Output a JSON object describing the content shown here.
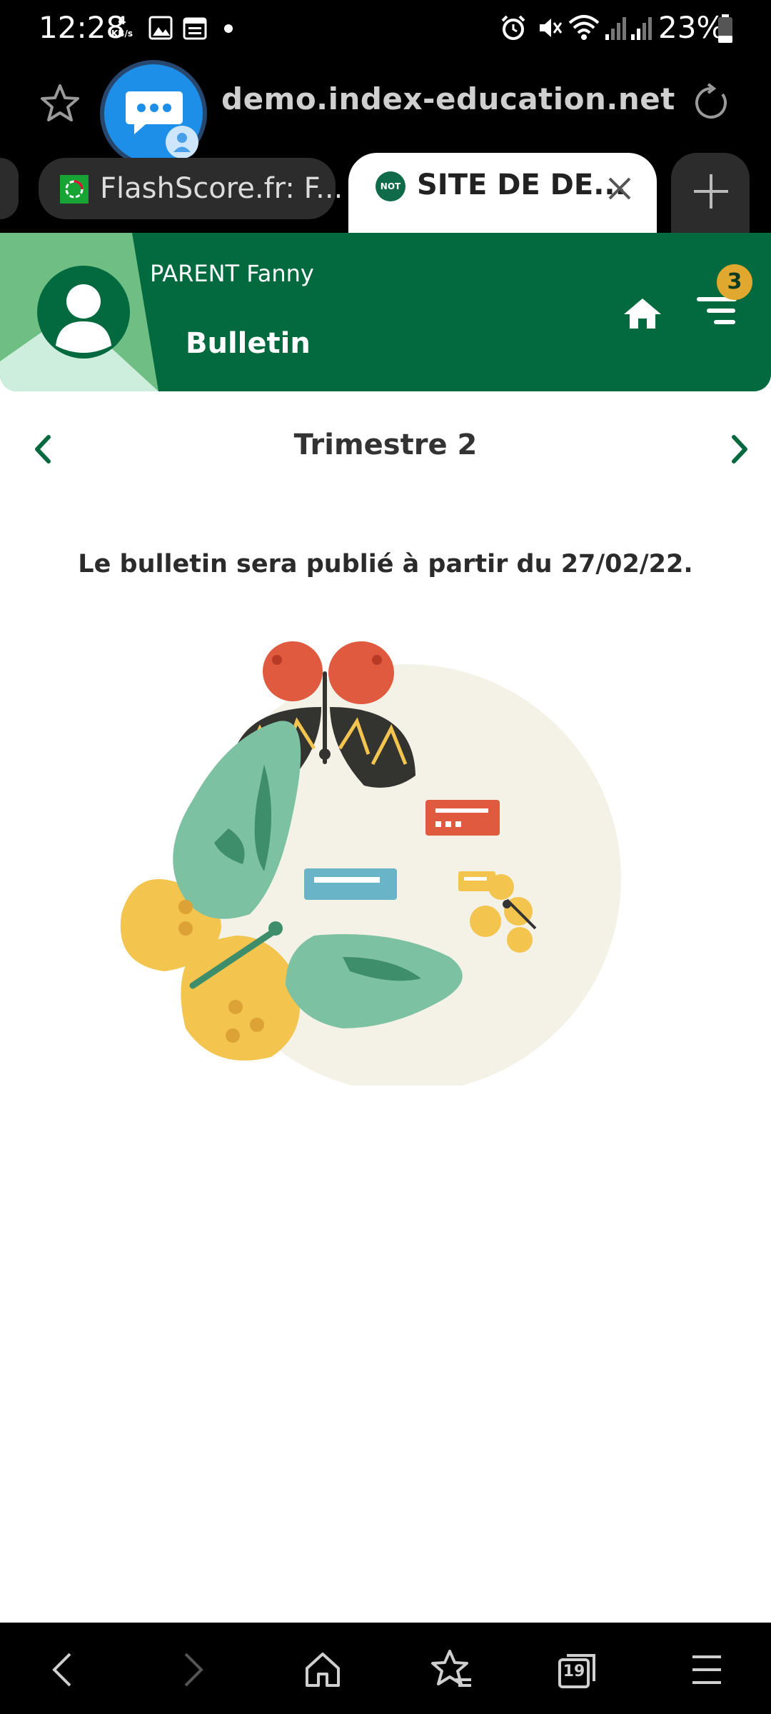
{
  "status_bar": {
    "time": "12:28",
    "net_speed_value": "4",
    "net_speed_unit": "KB/s",
    "battery": "23%",
    "icons": [
      "image-icon",
      "calendar-icon",
      "dot-icon",
      "alarm-icon",
      "mute-icon",
      "wifi-icon",
      "signal-icon",
      "signal-icon",
      "battery-icon"
    ]
  },
  "browser": {
    "url": "demo.index-education.net",
    "tabs": [
      {
        "label": "FlashScore.fr: F...",
        "active": false
      },
      {
        "label": "SITE DE DE...",
        "active": true,
        "favicon_text": "NOT"
      }
    ]
  },
  "header": {
    "user_name": "PARENT Fanny",
    "page_title": "Bulletin",
    "notification_count": "3"
  },
  "period": {
    "label": "Trimestre 2"
  },
  "message": "Le bulletin sera publié à partir du 27/02/22.",
  "bottom_nav": {
    "tabs_count": "19"
  },
  "colors": {
    "brand_green": "#036a3f",
    "light_green": "#6fbf85",
    "pale_green": "#cdeedd",
    "badge": "#e0a82e"
  }
}
